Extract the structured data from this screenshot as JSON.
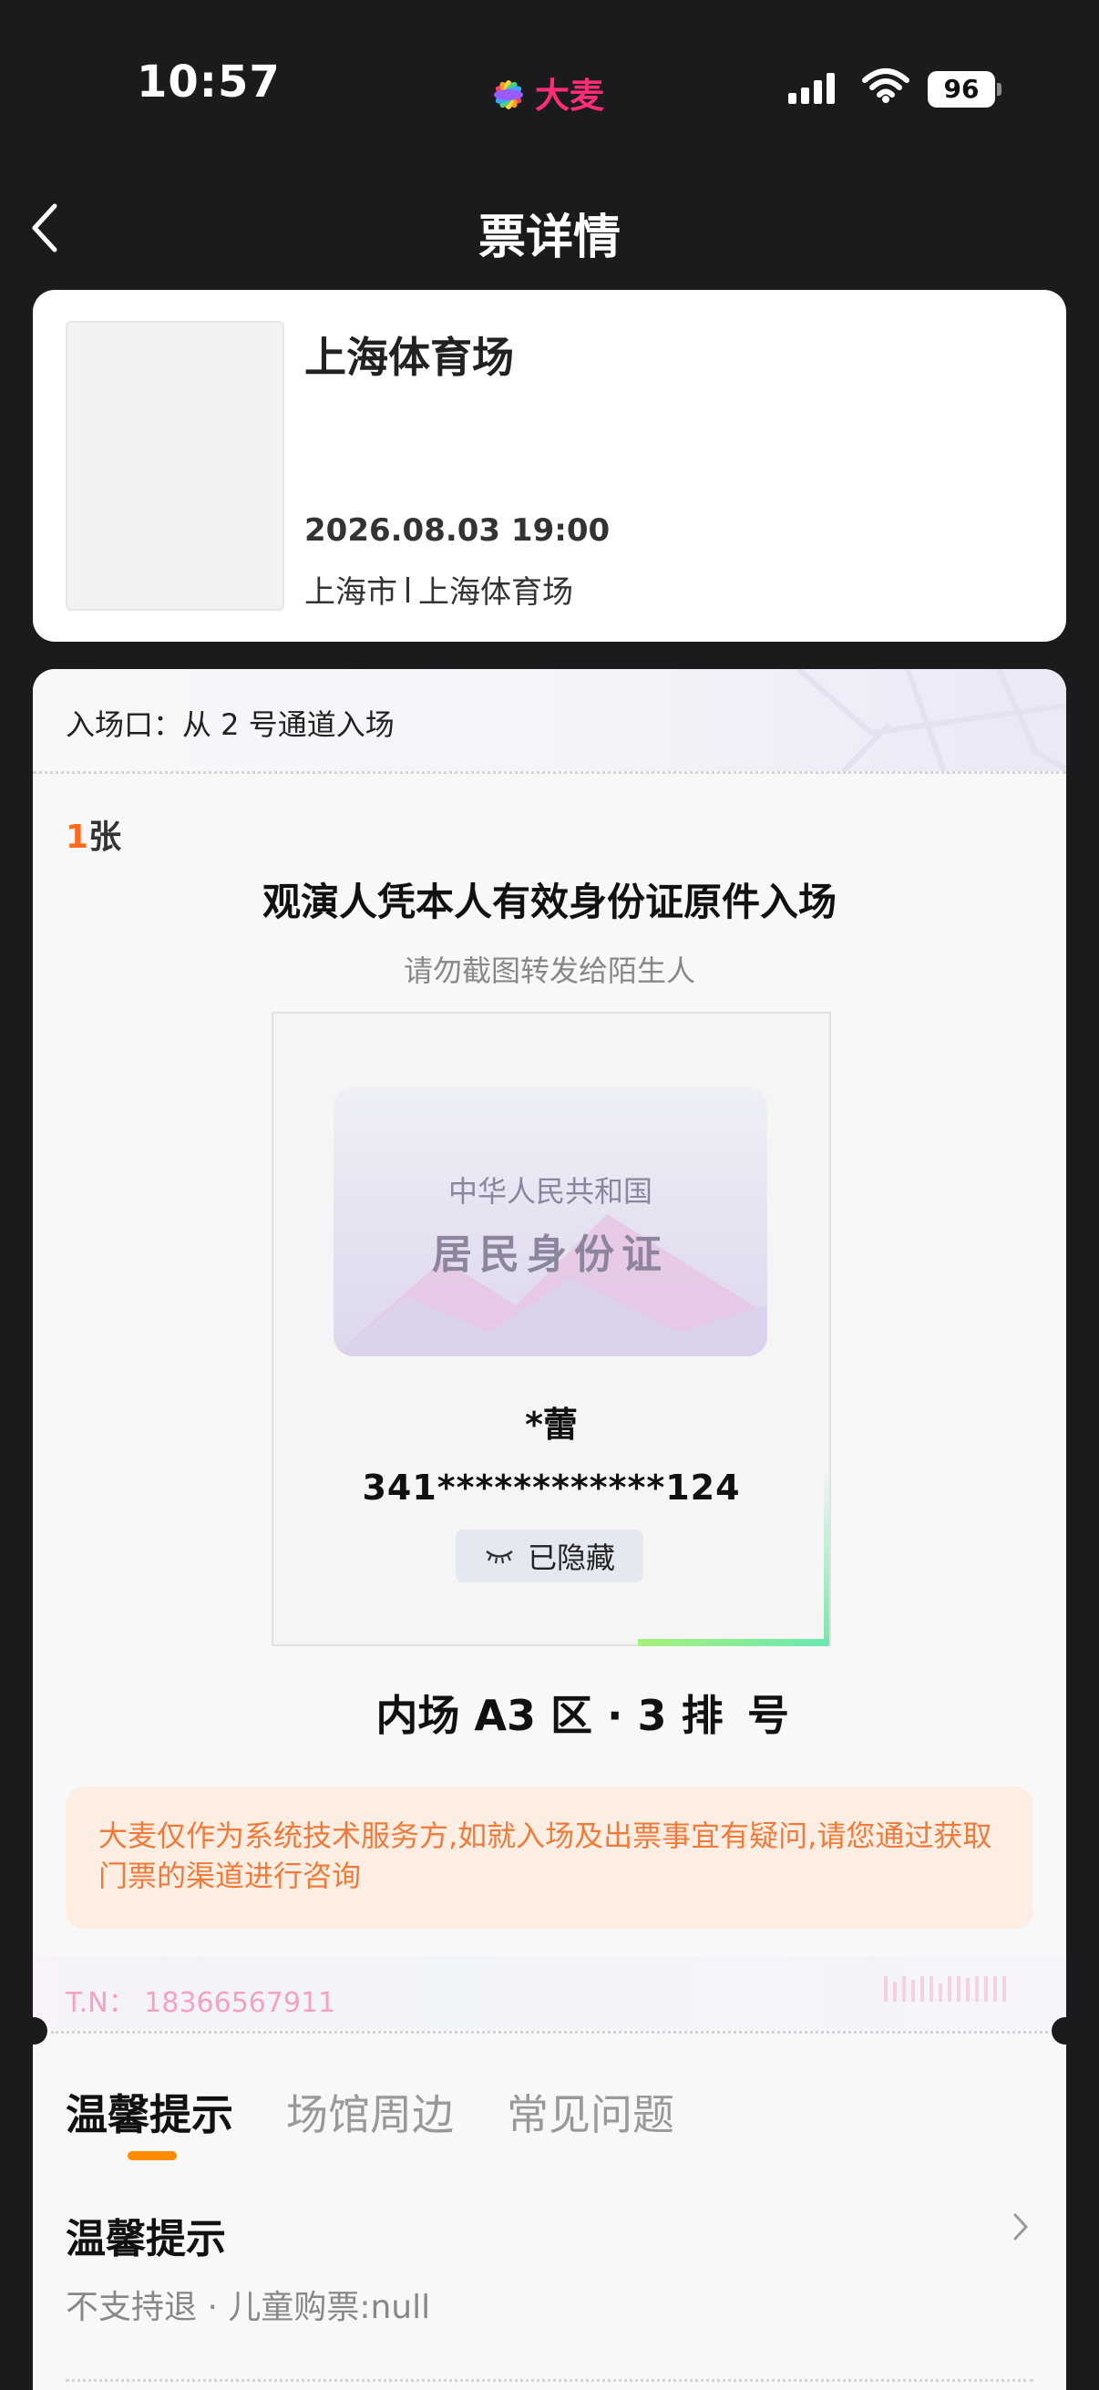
{
  "status_bar": {
    "time": "10:57",
    "brand": "大麦",
    "battery": "96"
  },
  "nav": {
    "title": "票详情"
  },
  "event": {
    "venue": "上海体育场",
    "datetime": "2026.08.03 19:00",
    "city": "上海市",
    "venue_short": "上海体育场"
  },
  "ticket": {
    "entry": "入场口：从 2 号通道入场",
    "count_number": "1",
    "count_unit": "张",
    "id_title": "观演人凭本人有效身份证原件入场",
    "warning": "请勿截图转发给陌生人",
    "id_card": {
      "country": "中华人民共和国",
      "type": "居民身份证"
    },
    "holder_name": "*蕾",
    "id_number": "341************124",
    "hidden_label": "已隐藏",
    "seat": "内场 A3 区 · 3 排",
    "seat_suffix": "号",
    "notice": "大麦仅作为系统技术服务方,如就入场及出票事宜有疑问,请您通过获取门票的渠道进行咨询",
    "tn": "T.N：  18366567911"
  },
  "tabs": [
    {
      "label": "温馨提示",
      "active": true
    },
    {
      "label": "场馆周边",
      "active": false
    },
    {
      "label": "常见问题",
      "active": false
    }
  ],
  "tips": {
    "title": "温馨提示",
    "body": "不支持退 · 儿童购票:null"
  },
  "colors": {
    "accent": "#ff8a00",
    "brand": "#ff2e74",
    "notice_text": "#f07a3a"
  }
}
